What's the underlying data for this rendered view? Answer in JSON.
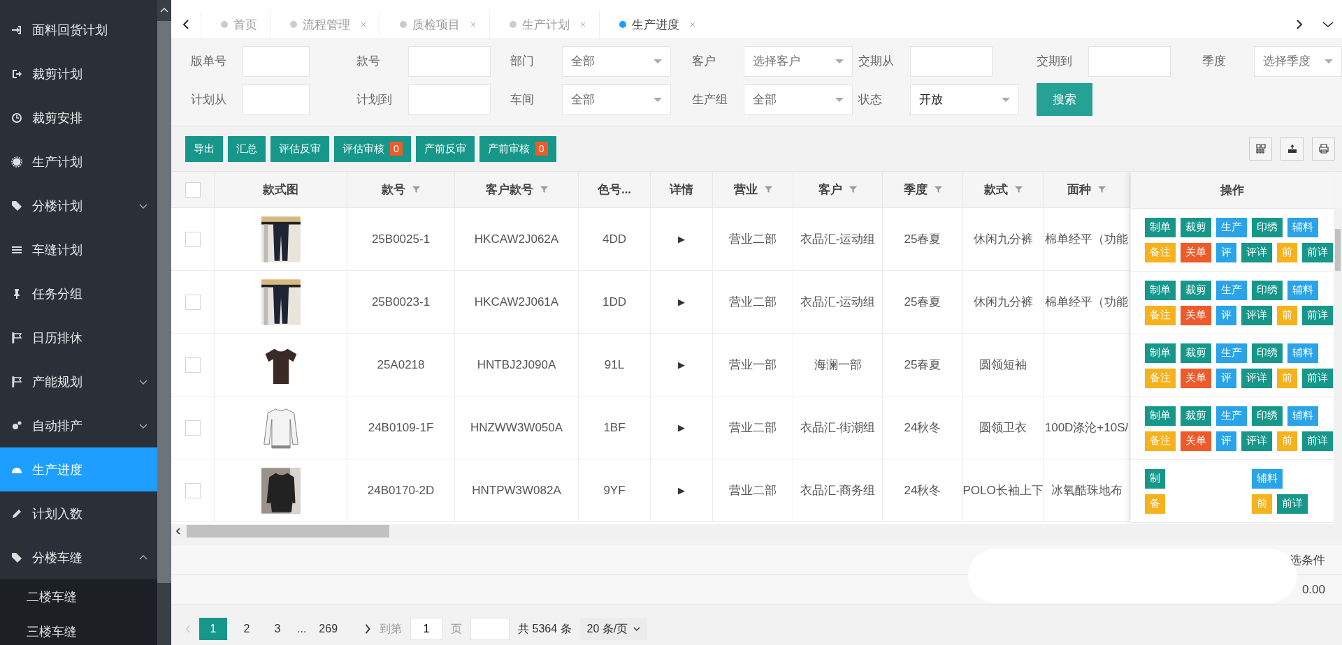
{
  "sidebar": {
    "items": [
      {
        "label": "面料回货计划",
        "selected": false
      },
      {
        "label": "裁剪计划",
        "selected": false
      },
      {
        "label": "裁剪安排",
        "selected": false
      },
      {
        "label": "生产计划",
        "selected": false
      },
      {
        "label": "分楼计划",
        "selected": false,
        "expanded": false
      },
      {
        "label": "车缝计划",
        "selected": false
      },
      {
        "label": "任务分组",
        "selected": false
      },
      {
        "label": "日历排休",
        "selected": false
      },
      {
        "label": "产能规划",
        "selected": false,
        "expanded": false
      },
      {
        "label": "自动排产",
        "selected": false,
        "expanded": false
      },
      {
        "label": "生产进度",
        "selected": true
      },
      {
        "label": "计划入数",
        "selected": false
      },
      {
        "label": "分楼车缝",
        "selected": false,
        "expanded": true,
        "children": [
          {
            "label": "二楼车缝"
          },
          {
            "label": "三楼车缝"
          }
        ]
      }
    ]
  },
  "tabs": [
    {
      "label": "首页",
      "closable": false,
      "selected": false
    },
    {
      "label": "流程管理",
      "closable": true,
      "selected": false
    },
    {
      "label": "质检项目",
      "closable": true,
      "selected": false
    },
    {
      "label": "生产计划",
      "closable": true,
      "selected": false
    },
    {
      "label": "生产进度",
      "closable": true,
      "selected": true
    }
  ],
  "filters": [
    {
      "label": "版单号",
      "kind": "input"
    },
    {
      "label": "款号",
      "kind": "input"
    },
    {
      "label": "部门",
      "kind": "select",
      "value": "全部"
    },
    {
      "label": "客户",
      "kind": "select",
      "placeholder": "选择客户"
    },
    {
      "label": "交期从",
      "kind": "input"
    },
    {
      "label": "交期到",
      "kind": "input"
    },
    {
      "label": "季度",
      "kind": "select",
      "placeholder": "选择季度"
    },
    {
      "label": "计划从",
      "kind": "input"
    },
    {
      "label": "计划到",
      "kind": "input"
    },
    {
      "label": "车间",
      "kind": "select",
      "value": "全部"
    },
    {
      "label": "生产组",
      "kind": "select",
      "value": "全部"
    },
    {
      "label": "状态",
      "kind": "select",
      "value": "开放"
    },
    {
      "label": "搜索",
      "kind": "button"
    }
  ],
  "toolbar": [
    {
      "label": "导出"
    },
    {
      "label": "汇总"
    },
    {
      "label": "评估反审"
    },
    {
      "label": "评估审核",
      "badge": "0"
    },
    {
      "label": "产前反审"
    },
    {
      "label": "产前审核",
      "badge": "0"
    }
  ],
  "table": {
    "select_all": {
      "checked": false
    },
    "columns": [
      {
        "label": "款式图",
        "filter": false
      },
      {
        "label": "款号",
        "filter": true
      },
      {
        "label": "客户款号",
        "filter": true
      },
      {
        "label": "色号...",
        "filter": false
      },
      {
        "label": "详情",
        "filter": false
      },
      {
        "label": "营业",
        "filter": true
      },
      {
        "label": "客户",
        "filter": true
      },
      {
        "label": "季度",
        "filter": true
      },
      {
        "label": "款式",
        "filter": true
      },
      {
        "label": "面种",
        "filter": true
      },
      {
        "label": "操作",
        "filter": false
      }
    ],
    "rows": [
      {
        "checked": false,
        "cells": [
          {
            "kind": "picture"
          },
          "25B0025-1",
          "HKCAW2J062A",
          "4DD",
          "▶",
          "营业二部",
          "衣品汇-运动组",
          "25春夏",
          "休闲九分裤",
          "棉单经平（功能"
        ],
        "actions": [
          [
            {
              "label": "制单",
              "color": "#16978a"
            },
            {
              "label": "裁剪",
              "color": "#16978a"
            },
            {
              "label": "生产",
              "color": "#2aa3e8"
            },
            {
              "label": "印绣",
              "color": "#16978a"
            },
            {
              "label": "辅料",
              "color": "#2aa3e8"
            }
          ],
          [
            {
              "label": "备注",
              "color": "#f5b21d"
            },
            {
              "label": "关单",
              "color": "#ee5a2a"
            },
            {
              "label": "评",
              "color": "#2aa3e8"
            },
            {
              "label": "评详",
              "color": "#16978a"
            },
            {
              "label": "前",
              "color": "#f5b21d"
            },
            {
              "label": "前详",
              "color": "#16978a"
            }
          ]
        ]
      },
      {
        "checked": false,
        "cells": [
          {
            "kind": "picture"
          },
          "25B0023-1",
          "HKCAW2J061A",
          "1DD",
          "▶",
          "营业二部",
          "衣品汇-运动组",
          "25春夏",
          "休闲九分裤",
          "棉单经平（功能"
        ],
        "actions": [
          [
            {
              "label": "制单",
              "color": "#16978a"
            },
            {
              "label": "裁剪",
              "color": "#16978a"
            },
            {
              "label": "生产",
              "color": "#2aa3e8"
            },
            {
              "label": "印绣",
              "color": "#16978a"
            },
            {
              "label": "辅料",
              "color": "#2aa3e8"
            }
          ],
          [
            {
              "label": "备注",
              "color": "#f5b21d"
            },
            {
              "label": "关单",
              "color": "#ee5a2a"
            },
            {
              "label": "评",
              "color": "#2aa3e8"
            },
            {
              "label": "评详",
              "color": "#16978a"
            },
            {
              "label": "前",
              "color": "#f5b21d"
            },
            {
              "label": "前详",
              "color": "#16978a"
            }
          ]
        ]
      },
      {
        "checked": false,
        "cells": [
          {
            "kind": "picture"
          },
          "25A0218",
          "HNTBJ2J090A",
          "91L",
          "▶",
          "营业一部",
          "海澜一部",
          "25春夏",
          "圆领短袖",
          ""
        ],
        "actions": [
          [
            {
              "label": "制单",
              "color": "#16978a"
            },
            {
              "label": "裁剪",
              "color": "#16978a"
            },
            {
              "label": "生产",
              "color": "#2aa3e8"
            },
            {
              "label": "印绣",
              "color": "#16978a"
            },
            {
              "label": "辅料",
              "color": "#2aa3e8"
            }
          ],
          [
            {
              "label": "备注",
              "color": "#f5b21d"
            },
            {
              "label": "关单",
              "color": "#ee5a2a"
            },
            {
              "label": "评",
              "color": "#2aa3e8"
            },
            {
              "label": "评详",
              "color": "#16978a"
            },
            {
              "label": "前",
              "color": "#f5b21d"
            },
            {
              "label": "前详",
              "color": "#16978a"
            }
          ]
        ]
      },
      {
        "checked": false,
        "cells": [
          {
            "kind": "picture"
          },
          "24B0109-1F",
          "HNZWW3W050A",
          "1BF",
          "▶",
          "营业二部",
          "衣品汇-街潮组",
          "24秋冬",
          "圆领卫衣",
          "100D涤沦+10S/"
        ],
        "actions": [
          [
            {
              "label": "制单",
              "color": "#16978a"
            },
            {
              "label": "裁剪",
              "color": "#16978a"
            },
            {
              "label": "生产",
              "color": "#2aa3e8"
            },
            {
              "label": "印绣",
              "color": "#16978a"
            },
            {
              "label": "辅料",
              "color": "#2aa3e8"
            }
          ],
          [
            {
              "label": "备注",
              "color": "#f5b21d"
            },
            {
              "label": "关单",
              "color": "#ee5a2a"
            },
            {
              "label": "评",
              "color": "#2aa3e8"
            },
            {
              "label": "评详",
              "color": "#16978a"
            },
            {
              "label": "前",
              "color": "#f5b21d"
            },
            {
              "label": "前详",
              "color": "#16978a"
            }
          ]
        ]
      },
      {
        "checked": false,
        "cells": [
          {
            "kind": "picture"
          },
          "24B0170-2D",
          "HNTPW3W082A",
          "9YF",
          "▶",
          "营业二部",
          "衣品汇-商务组",
          "24秋冬",
          "POLO长袖上下",
          "冰氧酷珠地布"
        ],
        "actions": [
          [
            {
              "label": "制",
              "color": "#16978a"
            },
            {
              "kind": "covered"
            },
            {
              "label": "辅料",
              "color": "#2aa3e8"
            }
          ],
          [
            {
              "label": "备",
              "color": "#f5b21d"
            },
            {
              "kind": "covered"
            },
            {
              "label": "前",
              "color": "#f5b21d"
            },
            {
              "label": "前详",
              "color": "#16978a"
            }
          ]
        ]
      }
    ]
  },
  "footer": {
    "texts": [
      "选条件",
      "0.00"
    ]
  },
  "pagination": {
    "previous": {
      "disabled": true
    },
    "pages": [
      {
        "label": "1",
        "selected": true
      },
      {
        "label": "2",
        "selected": false
      },
      {
        "label": "3",
        "selected": false
      },
      {
        "label": "...",
        "kind": "ellipsis"
      },
      {
        "label": "269",
        "selected": false
      }
    ],
    "goto_label": "到第",
    "goto_value": "1",
    "page_label": "页",
    "total": "共 5364 条",
    "page_size": "20 条/页"
  }
}
